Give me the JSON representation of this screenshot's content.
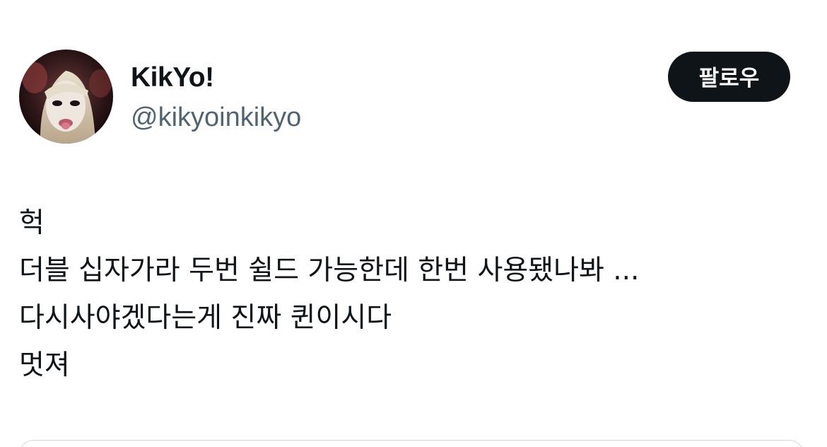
{
  "user": {
    "display_name": "KikYo!",
    "handle": "@kikyoinkikyo",
    "avatar_icon": "profile-photo"
  },
  "follow_button": {
    "label": "팔로우"
  },
  "tweet": {
    "lines": [
      "헉",
      "더블 십자가라 두번 쉴드 가능한데 한번 사용됐나봐 ...",
      "다시사야겠다는게 진짜 퀸이시다",
      "멋져"
    ]
  },
  "colors": {
    "text_primary": "#0f1419",
    "text_secondary": "#536471",
    "button_bg": "#0f1419",
    "button_text": "#ffffff",
    "border": "#cfd9de"
  }
}
